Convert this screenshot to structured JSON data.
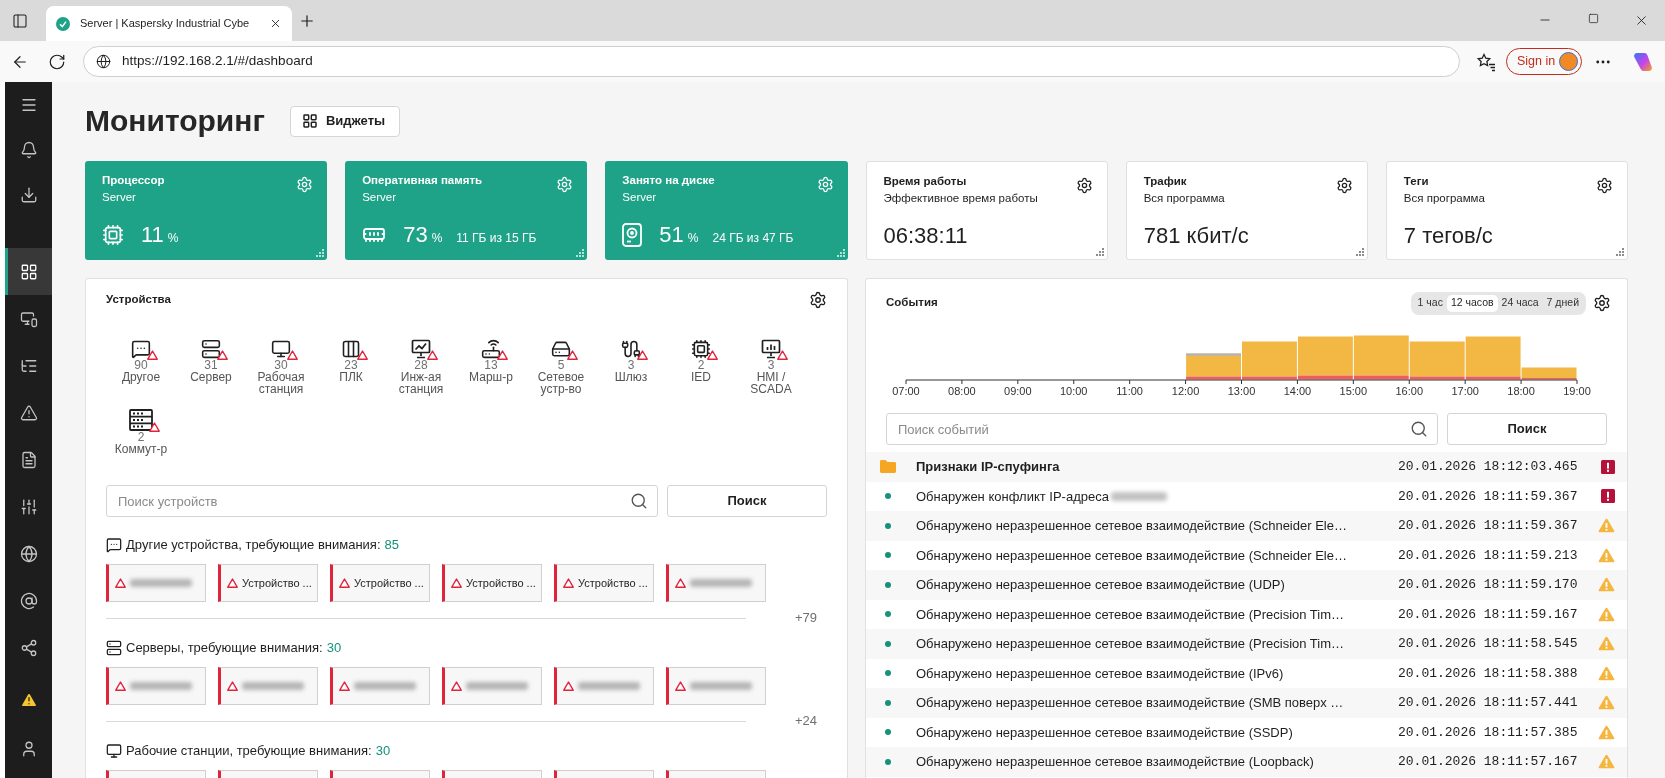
{
  "browser": {
    "tab_title": "Server | Kaspersky Industrial Cybe",
    "url": "https://192.168.2.1/#/dashboard",
    "sign_in": "Sign in"
  },
  "sidebar": {
    "top": [
      {
        "kind": "menu",
        "selected": false
      },
      {
        "kind": "notifications",
        "selected": false
      },
      {
        "kind": "downloads",
        "selected": false
      }
    ],
    "main": [
      {
        "kind": "dashboard",
        "selected": true
      },
      {
        "kind": "devices",
        "selected": false
      },
      {
        "kind": "topology",
        "selected": false
      },
      {
        "kind": "alerts",
        "selected": false
      },
      {
        "kind": "reports",
        "selected": false
      },
      {
        "kind": "settings",
        "selected": false
      },
      {
        "kind": "network",
        "selected": false
      },
      {
        "kind": "addresses",
        "selected": false
      },
      {
        "kind": "graph",
        "selected": false
      }
    ],
    "bottom": [
      {
        "kind": "warnings",
        "selected": false
      },
      {
        "kind": "user",
        "selected": false
      }
    ]
  },
  "header": {
    "title": "Мониторинг",
    "widgets_button": "Виджеты"
  },
  "metrics": [
    {
      "kind": "cpu",
      "title": "Процессор",
      "subtitle": "Server",
      "value": "11",
      "unit": "%"
    },
    {
      "kind": "memory",
      "title": "Оперативная память",
      "subtitle": "Server",
      "value": "73",
      "unit": "%",
      "detail": "11 ГБ из 15 ГБ"
    },
    {
      "kind": "disk",
      "title": "Занято на диске",
      "subtitle": "Server",
      "value": "51",
      "unit": "%",
      "detail": "24 ГБ из 47 ГБ"
    },
    {
      "kind": "uptime",
      "title": "Время работы",
      "subtitle": "Эффективное время работы",
      "value": "06:38:11"
    },
    {
      "kind": "traffic",
      "title": "Трафик",
      "subtitle": "Вся программа",
      "value": "781 кбит/с"
    },
    {
      "kind": "tags",
      "title": "Теги",
      "subtitle": "Вся программа",
      "value": "7 тегов/с"
    }
  ],
  "devices": {
    "title": "Устройства",
    "types": [
      {
        "kind": "other",
        "count": "90",
        "label": "Другое",
        "warning": true
      },
      {
        "kind": "server",
        "count": "31",
        "label": "Сервер",
        "warning": true
      },
      {
        "kind": "workstation",
        "count": "30",
        "label": "Рабочая станция",
        "warning": true
      },
      {
        "kind": "plc",
        "count": "23",
        "label": "ПЛК",
        "warning": true
      },
      {
        "kind": "engineering",
        "count": "28",
        "label": "Инж-ая станция",
        "warning": true
      },
      {
        "kind": "router",
        "count": "13",
        "label": "Марш-р",
        "warning": true
      },
      {
        "kind": "network",
        "count": "5",
        "label": "Сетевое устр-во",
        "warning": true
      },
      {
        "kind": "gateway",
        "count": "3",
        "label": "Шлюз",
        "warning": true
      },
      {
        "kind": "ied",
        "count": "2",
        "label": "IED",
        "warning": true
      },
      {
        "kind": "hmi",
        "count": "3",
        "label": "HMI / SCADA",
        "warning": true
      },
      {
        "kind": "switch",
        "count": "2",
        "label": "Коммут-р",
        "warning": true
      }
    ],
    "search": {
      "placeholder": "Поиск устройств",
      "button": "Поиск"
    },
    "sections": [
      {
        "kind": "other",
        "title": "Другие устройства, требующие внимания:",
        "count": "85",
        "cards": [
          {
            "kind": "hidden"
          },
          {
            "kind": "named",
            "label": "Устройство ..."
          },
          {
            "kind": "named",
            "label": "Устройство ..."
          },
          {
            "kind": "named",
            "label": "Устройство ..."
          },
          {
            "kind": "named",
            "label": "Устройство ..."
          },
          {
            "kind": "hidden"
          }
        ],
        "more": "+79"
      },
      {
        "kind": "server",
        "title": "Серверы, требующие внимания:",
        "count": "30",
        "cards": [
          {
            "kind": "hidden"
          },
          {
            "kind": "hidden"
          },
          {
            "kind": "hidden"
          },
          {
            "kind": "hidden"
          },
          {
            "kind": "hidden"
          },
          {
            "kind": "hidden"
          }
        ],
        "more": "+24"
      },
      {
        "kind": "workstation",
        "title": "Рабочие станции, требующие внимания:",
        "count": "30",
        "cards": [
          {
            "kind": "cut"
          },
          {
            "kind": "cut"
          },
          {
            "kind": "cut"
          },
          {
            "kind": "cut"
          },
          {
            "kind": "cut"
          },
          {
            "kind": "cut"
          }
        ]
      }
    ]
  },
  "events": {
    "title": "События",
    "ranges": [
      {
        "label": "1 час",
        "selected": false
      },
      {
        "label": "12 часов",
        "selected": true
      },
      {
        "label": "24 часа",
        "selected": false
      },
      {
        "label": "7 дней",
        "selected": false
      }
    ],
    "chart": {
      "axis_labels": [
        "07:00",
        "08:00",
        "09:00",
        "10:00",
        "11:00",
        "12:00",
        "13:00",
        "14:00",
        "15:00",
        "16:00",
        "17:00",
        "18:00",
        "19:00"
      ]
    },
    "search": {
      "placeholder": "Поиск событий",
      "button": "Поиск"
    },
    "rows": [
      {
        "kind": "group",
        "text": "Признаки IP-спуфинга",
        "time": "20.01.2026 18:12:03.465",
        "critical": true,
        "redacted": false
      },
      {
        "kind": "event",
        "text": "Обнаружен конфликт IP-адреса",
        "time": "20.01.2026 18:11:59.367",
        "critical": true,
        "redacted": true
      },
      {
        "kind": "event",
        "text": "Обнаружено неразрешенное сетевое взаимодействие (Schneider Ele…",
        "time": "20.01.2026 18:11:59.367",
        "critical": false,
        "redacted": false
      },
      {
        "kind": "event",
        "text": "Обнаружено неразрешенное сетевое взаимодействие (Schneider Ele…",
        "time": "20.01.2026 18:11:59.213",
        "critical": false,
        "redacted": false
      },
      {
        "kind": "event",
        "text": "Обнаружено неразрешенное сетевое взаимодействие (UDP)",
        "time": "20.01.2026 18:11:59.170",
        "critical": false,
        "redacted": false
      },
      {
        "kind": "event",
        "text": "Обнаружено неразрешенное сетевое взаимодействие (Precision Tim…",
        "time": "20.01.2026 18:11:59.167",
        "critical": false,
        "redacted": false
      },
      {
        "kind": "event",
        "text": "Обнаружено неразрешенное сетевое взаимодействие (Precision Tim…",
        "time": "20.01.2026 18:11:58.545",
        "critical": false,
        "redacted": false
      },
      {
        "kind": "event",
        "text": "Обнаружено неразрешенное сетевое взаимодействие (IPv6)",
        "time": "20.01.2026 18:11:58.388",
        "critical": false,
        "redacted": false
      },
      {
        "kind": "event",
        "text": "Обнаружено неразрешенное сетевое взаимодействие (SMB поверх …",
        "time": "20.01.2026 18:11:57.441",
        "critical": false,
        "redacted": false
      },
      {
        "kind": "event",
        "text": "Обнаружено неразрешенное сетевое взаимодействие (SSDP)",
        "time": "20.01.2026 18:11:57.385",
        "critical": false,
        "redacted": false
      },
      {
        "kind": "event",
        "text": "Обнаружено неразрешенное сетевое взаимодействие (Loopback)",
        "time": "20.01.2026 18:11:57.167",
        "critical": false,
        "redacted": false
      }
    ]
  }
}
